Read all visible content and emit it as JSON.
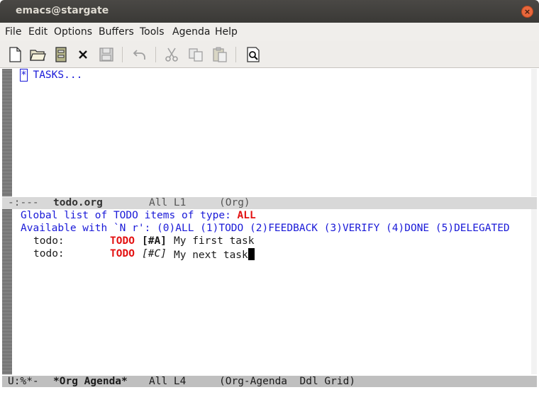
{
  "window": {
    "title": "emacs@stargate",
    "close_glyph": "×"
  },
  "menu": [
    "File",
    "Edit",
    "Options",
    "Buffers",
    "Tools",
    "Agenda",
    "Help"
  ],
  "toolbar_icons": [
    "new-file-icon",
    "open-folder-icon",
    "directory-icon",
    "kill-buffer-icon",
    "save-icon",
    "undo-icon",
    "cut-icon",
    "copy-icon",
    "paste-icon",
    "search-icon"
  ],
  "top_buffer": {
    "star": "*",
    "heading": "TASKS...",
    "modeline": {
      "status": "-:---",
      "name": "todo.org",
      "position": "All L1",
      "mode": "(Org)"
    }
  },
  "agenda": {
    "line1_prefix": "Global list of TODO items of type: ",
    "line1_type": "ALL",
    "line2": "Available with `N r': (0)ALL (1)TODO (2)FEEDBACK (3)VERIFY (4)DONE (5)DELEGATED",
    "items": [
      {
        "category": "todo:",
        "keyword": "TODO",
        "priority": "[#A]",
        "text": "My first task"
      },
      {
        "category": "todo:",
        "keyword": "TODO",
        "priority": "[#C]",
        "text": "My next task"
      }
    ],
    "modeline": {
      "status": "U:%*-",
      "name": "*Org Agenda*",
      "position": "All L4",
      "mode": "(Org-Agenda  Ddl Grid)"
    }
  },
  "colors": {
    "keyword": "#e31010",
    "link": "#1a1ad8",
    "modeline": "#bfbfbf",
    "titlebar": "#3c3b37"
  }
}
